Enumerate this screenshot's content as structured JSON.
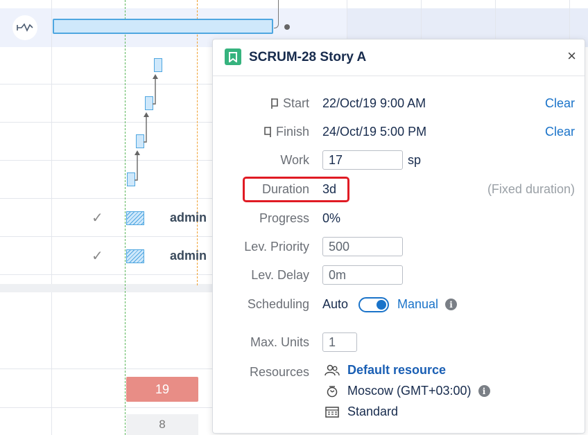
{
  "popup": {
    "issue_key": "SCRUM-28",
    "issue_title": "Story A",
    "close_glyph": "×",
    "start": {
      "label": "Start",
      "value": "22/Oct/19 9:00 AM",
      "clear_label": "Clear"
    },
    "finish": {
      "label": "Finish",
      "value": "24/Oct/19 5:00 PM",
      "clear_label": "Clear"
    },
    "work": {
      "label": "Work",
      "value": "17",
      "unit": "sp"
    },
    "duration": {
      "label": "Duration",
      "value": "3d",
      "note": "(Fixed duration)"
    },
    "progress": {
      "label": "Progress",
      "value": "0%"
    },
    "lev_priority": {
      "label": "Lev. Priority",
      "value": "500"
    },
    "lev_delay": {
      "label": "Lev. Delay",
      "value": "0m"
    },
    "scheduling": {
      "label": "Scheduling",
      "auto_label": "Auto",
      "manual_label": "Manual",
      "mode": "manual"
    },
    "max_units": {
      "label": "Max. Units",
      "value": "1"
    },
    "resources": {
      "label": "Resources",
      "resource_name": "Default resource",
      "timezone": "Moscow (GMT+03:00)",
      "calendar": "Standard"
    }
  },
  "gantt": {
    "rows": [
      {
        "assignee": "admin"
      },
      {
        "assignee": "admin"
      }
    ],
    "cells": {
      "red_value": "19",
      "gray_value": "8"
    }
  },
  "colors": {
    "accent": "#1a73c9",
    "story_icon": "#36b37e",
    "highlight": "#e01b24",
    "bar_fill": "#cfe8fb",
    "bar_border": "#4ea6e0",
    "red_cell": "#e88d86"
  },
  "icons": {
    "start": "flag-start-icon",
    "finish": "flag-finish-icon",
    "story": "bookmark-icon",
    "resource": "people-icon",
    "timezone": "clock-icon",
    "calendar": "calendar-icon",
    "info": "info-icon"
  }
}
